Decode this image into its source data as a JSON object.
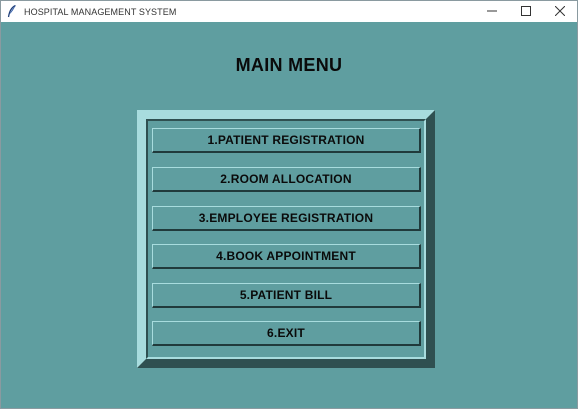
{
  "window": {
    "title": "HOSPITAL MANAGEMENT SYSTEM",
    "icon": "feather-icon",
    "controls": [
      "minimize-icon",
      "maximize-icon",
      "close-icon"
    ]
  },
  "main": {
    "heading": "MAIN MENU",
    "buttons": [
      {
        "label": "1.PATIENT REGISTRATION"
      },
      {
        "label": "2.ROOM ALLOCATION"
      },
      {
        "label": "3.EMPLOYEE REGISTRATION"
      },
      {
        "label": "4.BOOK APPOINTMENT"
      },
      {
        "label": "5.PATIENT BILL"
      },
      {
        "label": "6.EXIT"
      }
    ]
  },
  "colors": {
    "background": "#5f9ea0",
    "frame_light": "#a8dcde",
    "frame_dark": "#2f5051",
    "text": "#0a0a0a"
  }
}
